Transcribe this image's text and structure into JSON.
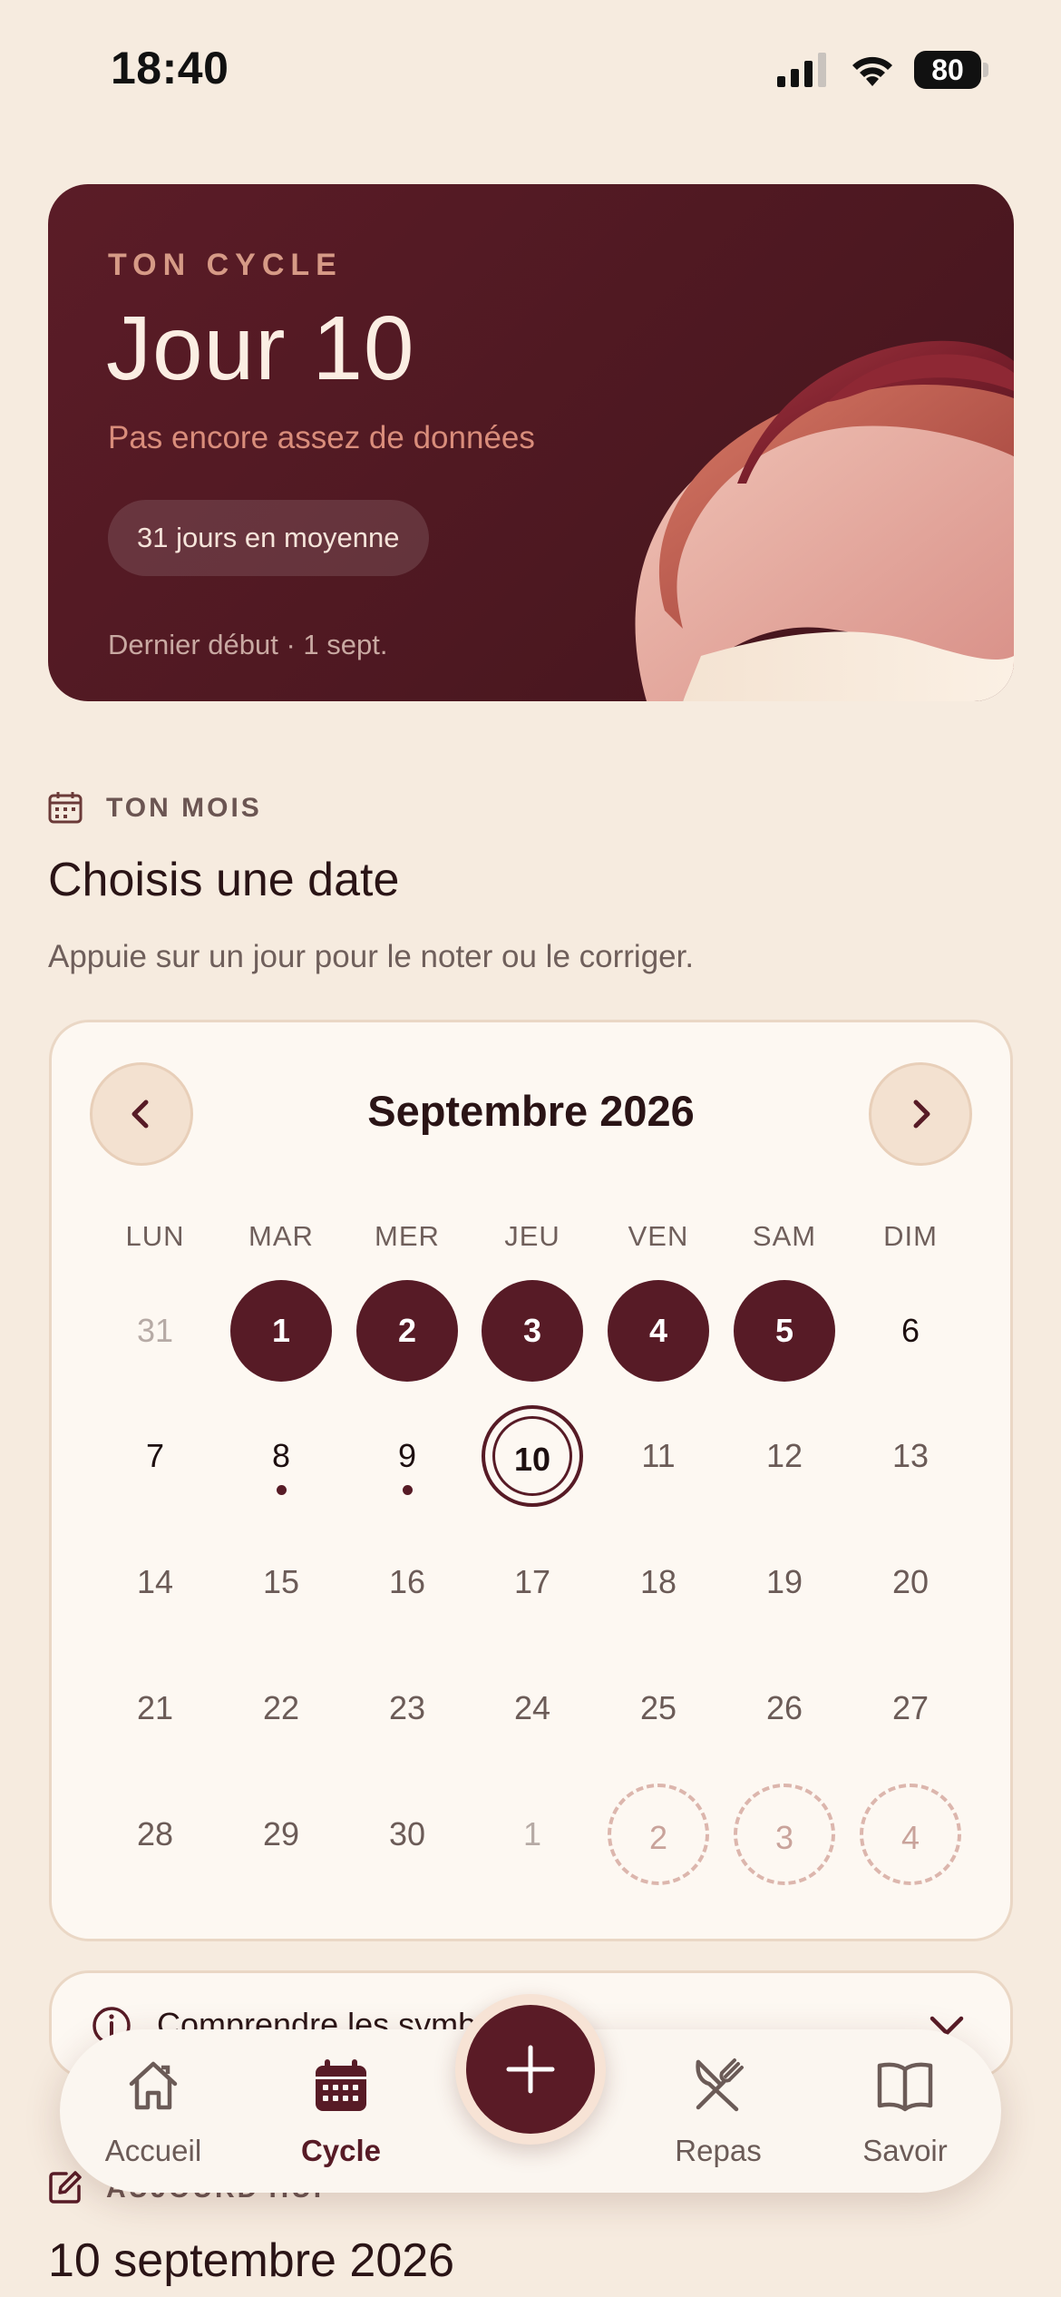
{
  "status_bar": {
    "time": "18:40",
    "battery": "80"
  },
  "cycle_card": {
    "eyebrow": "TON CYCLE",
    "day": "Jour 10",
    "subtitle": "Pas encore assez de données",
    "average": "31 jours en moyenne",
    "last_start": "Dernier début · 1 sept."
  },
  "month_section": {
    "eyebrow": "TON MOIS",
    "title": "Choisis une date",
    "description": "Appuie sur un jour pour le noter ou le corriger."
  },
  "calendar": {
    "month_label": "Septembre 2026",
    "weekdays": [
      "LUN",
      "MAR",
      "MER",
      "JEU",
      "VEN",
      "SAM",
      "DIM"
    ],
    "weeks": [
      [
        {
          "label": "31",
          "state": "outside"
        },
        {
          "label": "1",
          "state": "period"
        },
        {
          "label": "2",
          "state": "period"
        },
        {
          "label": "3",
          "state": "period"
        },
        {
          "label": "4",
          "state": "period"
        },
        {
          "label": "5",
          "state": "period"
        },
        {
          "label": "6",
          "state": "past"
        }
      ],
      [
        {
          "label": "7",
          "state": "past"
        },
        {
          "label": "8",
          "state": "past",
          "logged": true
        },
        {
          "label": "9",
          "state": "past",
          "logged": true
        },
        {
          "label": "10",
          "state": "today"
        },
        {
          "label": "11",
          "state": "future"
        },
        {
          "label": "12",
          "state": "future"
        },
        {
          "label": "13",
          "state": "future"
        }
      ],
      [
        {
          "label": "14",
          "state": "future"
        },
        {
          "label": "15",
          "state": "future"
        },
        {
          "label": "16",
          "state": "future"
        },
        {
          "label": "17",
          "state": "future"
        },
        {
          "label": "18",
          "state": "future"
        },
        {
          "label": "19",
          "state": "future"
        },
        {
          "label": "20",
          "state": "future"
        }
      ],
      [
        {
          "label": "21",
          "state": "future"
        },
        {
          "label": "22",
          "state": "future"
        },
        {
          "label": "23",
          "state": "future"
        },
        {
          "label": "24",
          "state": "future"
        },
        {
          "label": "25",
          "state": "future"
        },
        {
          "label": "26",
          "state": "future"
        },
        {
          "label": "27",
          "state": "future"
        }
      ],
      [
        {
          "label": "28",
          "state": "future"
        },
        {
          "label": "29",
          "state": "future"
        },
        {
          "label": "30",
          "state": "future"
        },
        {
          "label": "1",
          "state": "outside"
        },
        {
          "label": "2",
          "state": "predicted"
        },
        {
          "label": "3",
          "state": "predicted"
        },
        {
          "label": "4",
          "state": "predicted"
        }
      ]
    ]
  },
  "understand_card": {
    "title": "Comprendre les symboles"
  },
  "today_section": {
    "eyebrow": "AUJOURD'HUI",
    "date": "10 septembre 2026"
  },
  "bottom_nav": {
    "items": [
      {
        "label": "Accueil",
        "icon": "home-icon",
        "active": false
      },
      {
        "label": "Cycle",
        "icon": "calendar-icon",
        "active": true
      },
      {
        "label": "Repas",
        "icon": "utensils-icon",
        "active": false
      },
      {
        "label": "Savoir",
        "icon": "book-icon",
        "active": false
      }
    ],
    "fab_icon": "plus-icon"
  },
  "colors": {
    "background": "#f6ebdf",
    "brand": "#571b26",
    "accent": "#d98d7b",
    "surface": "#fdf8f2"
  }
}
